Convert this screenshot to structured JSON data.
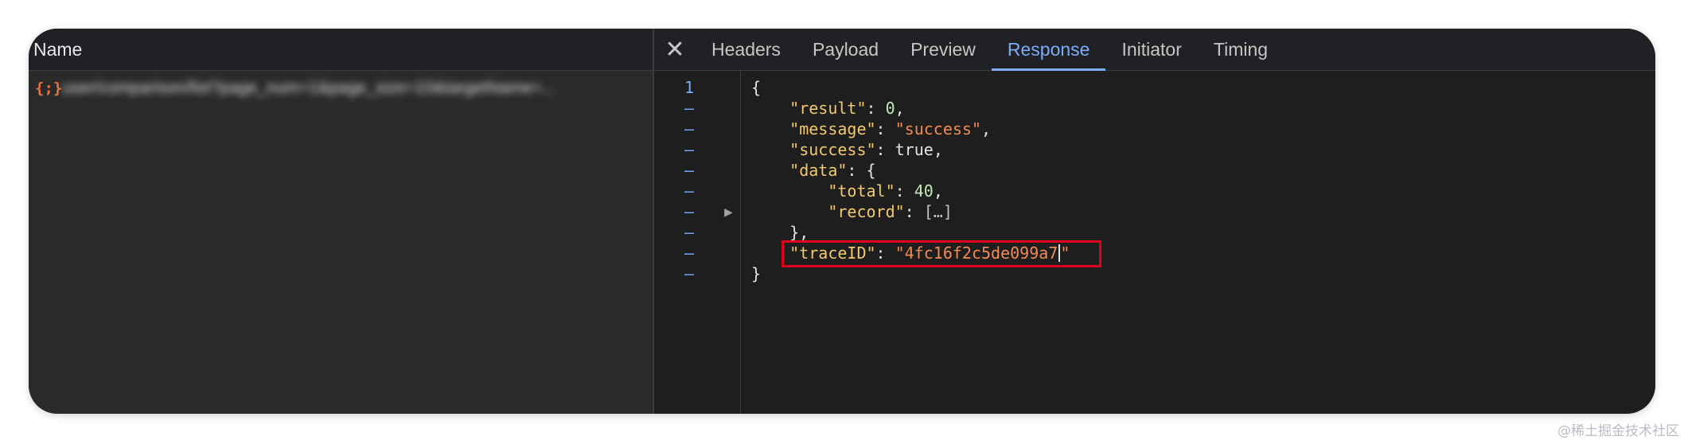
{
  "left_panel": {
    "header": "Name",
    "request": {
      "icon": "{;}",
      "name": "user/comparison/list?page_num=1&page_size=10&targetName=..."
    }
  },
  "tabs": {
    "close_icon": "✕",
    "items": [
      "Headers",
      "Payload",
      "Preview",
      "Response",
      "Initiator",
      "Timing"
    ],
    "active": "Response"
  },
  "response": {
    "line_numbers": [
      "1",
      "–",
      "–",
      "–",
      "–",
      "–",
      "–",
      "–",
      "–",
      "–"
    ],
    "lines": {
      "l1": "{",
      "result_key": "\"result\"",
      "result_val": "0",
      "message_key": "\"message\"",
      "message_val": "\"success\"",
      "success_key": "\"success\"",
      "success_val": "true",
      "data_key": "\"data\"",
      "total_key": "\"total\"",
      "total_val": "40",
      "record_key": "\"record\"",
      "record_val": "[…]",
      "traceid_key": "\"traceID\"",
      "traceid_val_main": "\"4fc16f2c5de099a7",
      "traceid_val_end": "\"",
      "last": "}"
    }
  },
  "watermark": "@稀土掘金技术社区",
  "colors": {
    "accent": "#7cacf8",
    "highlight_border": "#e0001b",
    "json_key": "#f2c96d",
    "json_string": "#f28b54",
    "json_number": "#c6e7b6"
  }
}
